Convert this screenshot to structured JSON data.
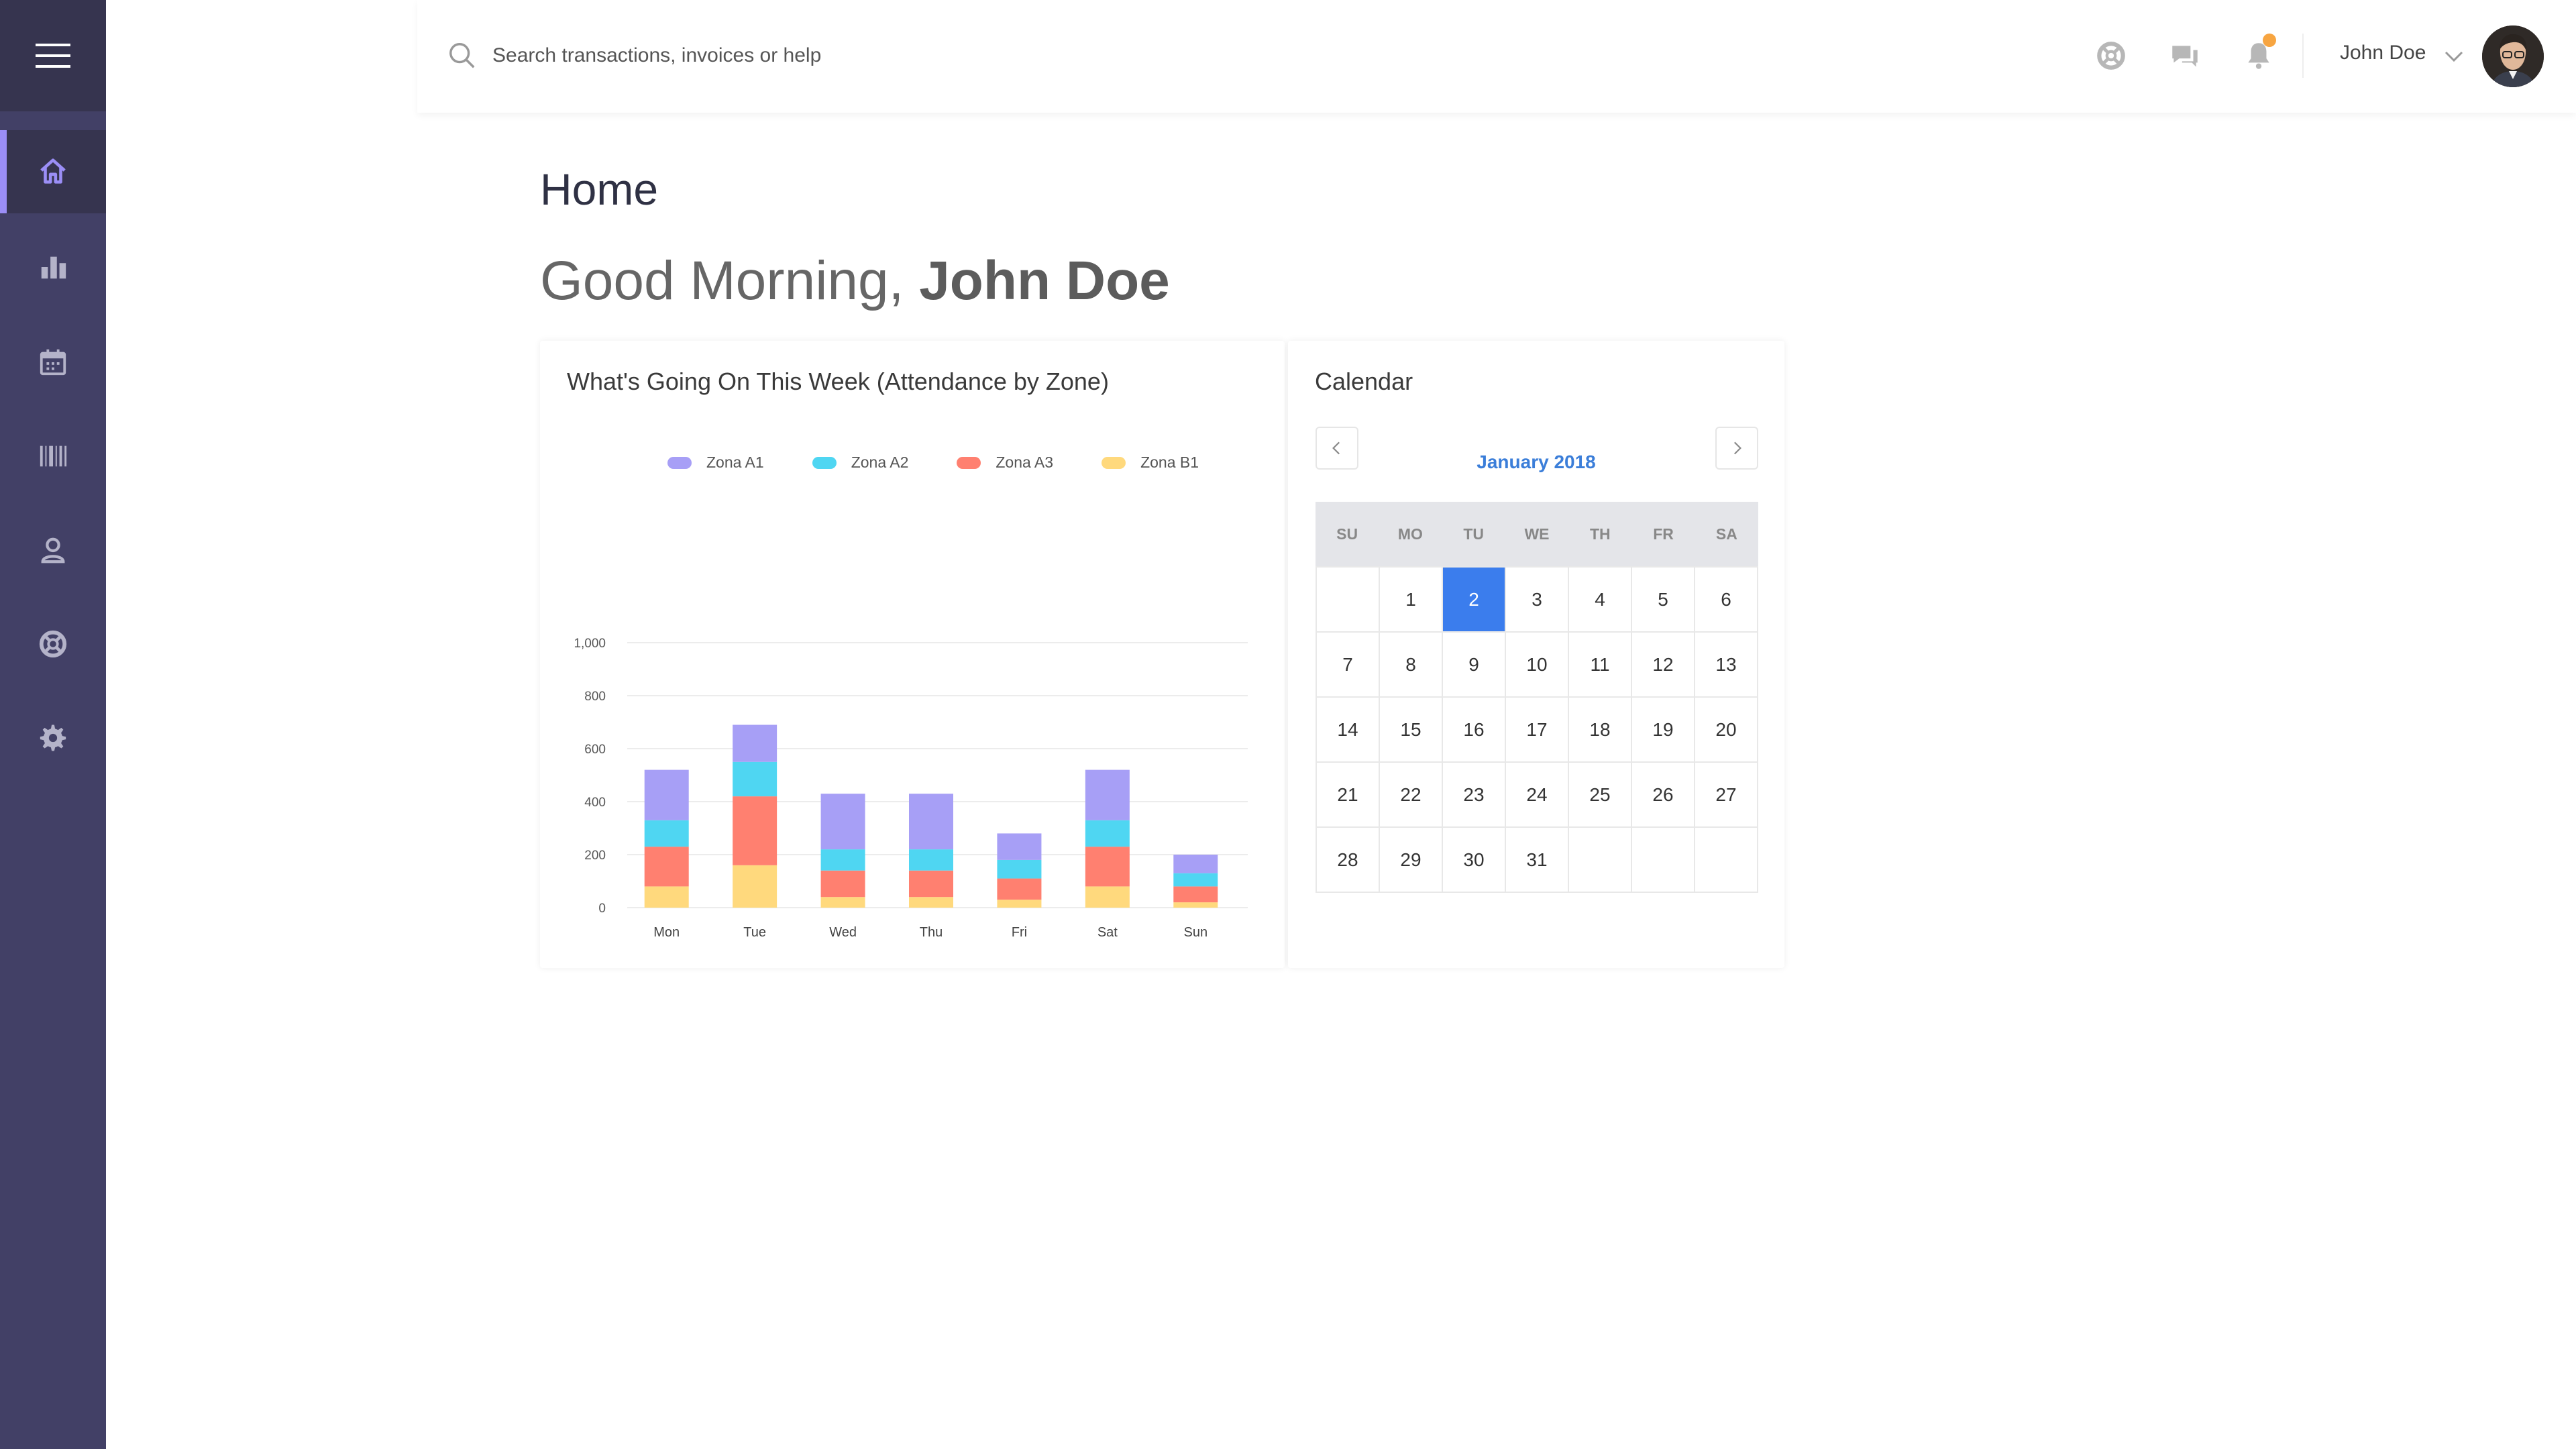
{
  "sidebar": {
    "items": [
      {
        "name": "home",
        "icon": "home-icon",
        "active": true
      },
      {
        "name": "analytics",
        "icon": "bar-chart-icon",
        "active": false
      },
      {
        "name": "calendar",
        "icon": "calendar-icon",
        "active": false
      },
      {
        "name": "inventory",
        "icon": "barcode-icon",
        "active": false
      },
      {
        "name": "profile",
        "icon": "user-icon",
        "active": false
      },
      {
        "name": "support",
        "icon": "lifebuoy-icon",
        "active": false
      },
      {
        "name": "settings",
        "icon": "gear-icon",
        "active": false
      }
    ]
  },
  "header": {
    "search_placeholder": "Search transactions, invoices or help",
    "user_name": "John Doe",
    "notification_dot_color": "#f7a541"
  },
  "page": {
    "title": "Home",
    "greeting_prefix": "Good Morning, ",
    "greeting_name": "John Doe"
  },
  "chart_card": {
    "title": "What's Going On This Week (Attendance by Zone)"
  },
  "chart_data": {
    "type": "bar",
    "stacked": true,
    "categories": [
      "Mon",
      "Tue",
      "Wed",
      "Thu",
      "Fri",
      "Sat",
      "Sun"
    ],
    "series": [
      {
        "name": "Zona B1",
        "color": "#ffd97d",
        "values": [
          80,
          160,
          40,
          40,
          30,
          80,
          20
        ]
      },
      {
        "name": "Zona A3",
        "color": "#ff8070",
        "values": [
          150,
          260,
          100,
          100,
          80,
          150,
          60
        ]
      },
      {
        "name": "Zona A2",
        "color": "#4fd6f2",
        "values": [
          100,
          130,
          80,
          80,
          70,
          100,
          50
        ]
      },
      {
        "name": "Zona A1",
        "color": "#a79ff6",
        "values": [
          190,
          140,
          210,
          210,
          100,
          190,
          70
        ]
      }
    ],
    "legend_order": [
      "Zona A1",
      "Zona A2",
      "Zona A3",
      "Zona B1"
    ],
    "y_ticks": [
      "0",
      "200",
      "400",
      "600",
      "800",
      "1,000"
    ],
    "ylim": [
      0,
      1000
    ],
    "grid": true,
    "legend_position": "top"
  },
  "calendar": {
    "title": "Calendar",
    "month_label": "January 2018",
    "weekdays": [
      "SU",
      "MO",
      "TU",
      "WE",
      "TH",
      "FR",
      "SA"
    ],
    "days": [
      "",
      "1",
      "2",
      "3",
      "4",
      "5",
      "6",
      "7",
      "8",
      "9",
      "10",
      "11",
      "12",
      "13",
      "14",
      "15",
      "16",
      "17",
      "18",
      "19",
      "20",
      "21",
      "22",
      "23",
      "24",
      "25",
      "26",
      "27",
      "28",
      "29",
      "30",
      "31",
      "",
      "",
      ""
    ],
    "selected_day": "2"
  }
}
